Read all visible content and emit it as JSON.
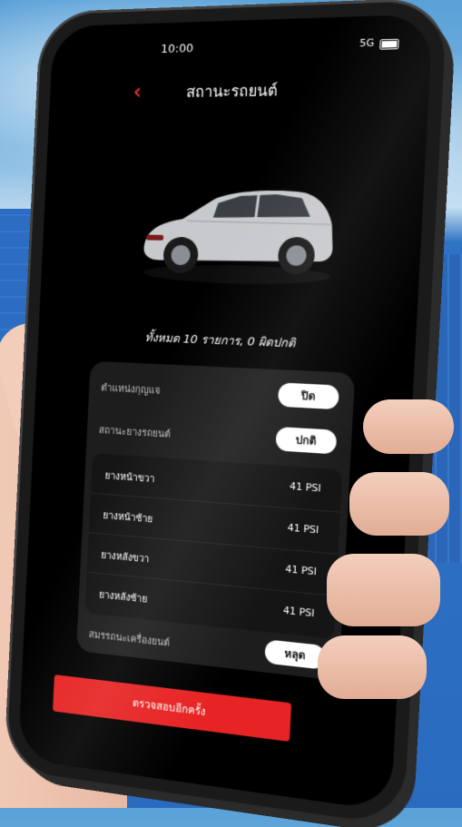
{
  "status": {
    "time": "10:00",
    "network": "5G"
  },
  "header": {
    "title": "สถานะรถยนต์"
  },
  "summary": "ทั้งหมด 10 รายการ, 0 ผิดปกติ",
  "status_rows": [
    {
      "label": "ตำแหน่งกุญแจ",
      "value": "ปิด"
    },
    {
      "label": "สถานะยางรถยนต์",
      "value": "ปกติ"
    },
    {
      "label": "สมรรถนะเครื่องยนต์",
      "value": "หลุด"
    }
  ],
  "tires": [
    {
      "name": "ยางหน้าขวา",
      "value": "41 PSI"
    },
    {
      "name": "ยางหน้าซ้าย",
      "value": "41 PSI"
    },
    {
      "name": "ยางหลังขวา",
      "value": "41 PSI"
    },
    {
      "name": "ยางหลังซ้าย",
      "value": "41 PSI"
    }
  ],
  "cta": {
    "label": "ตรวจสอบอีกครั้ง"
  },
  "colors": {
    "accent": "#e72424",
    "screen_bg": "#000000",
    "card_bg": "#1d1d1d"
  }
}
